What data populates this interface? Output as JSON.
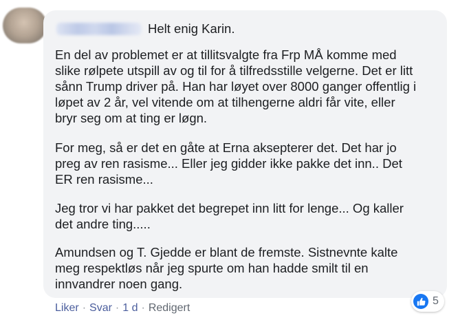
{
  "comment": {
    "first_line": "Helt enig Karin.",
    "paragraphs": [
      [
        "En del av problemet er at tillitsvalgte fra Frp MÅ komme med",
        "slike rølpete utspill av og til for å tilfredsstille velgerne. Det er litt",
        "sånn Trump driver på. Han har løyet over 8000 ganger offentlig i",
        "løpet av 2 år, vel vitende om at tilhengerne aldri får vite, eller",
        "bryr seg om at ting er løgn."
      ],
      [
        "For meg, så er det en gåte at Erna aksepterer det. Det har jo",
        "preg av ren rasisme... Eller jeg gidder ikke pakke det inn.. Det",
        "ER ren rasisme..."
      ],
      [
        "Jeg tror vi har pakket det begrepet inn litt for lenge... Og kaller",
        "det andre ting....."
      ],
      [
        "Amundsen og T. Gjedde er blant de fremste. Sistnevnte kalte",
        "meg respektløs når jeg spurte om han hadde smilt til en",
        "innvandrer noen gang."
      ]
    ]
  },
  "actions": {
    "like": "Liker",
    "reply": "Svar",
    "time": "1 d",
    "edited": "Redigert",
    "separator": "·"
  },
  "reactions": {
    "icon": "thumbs-up-icon",
    "count": "5",
    "color": "#1877f2"
  }
}
